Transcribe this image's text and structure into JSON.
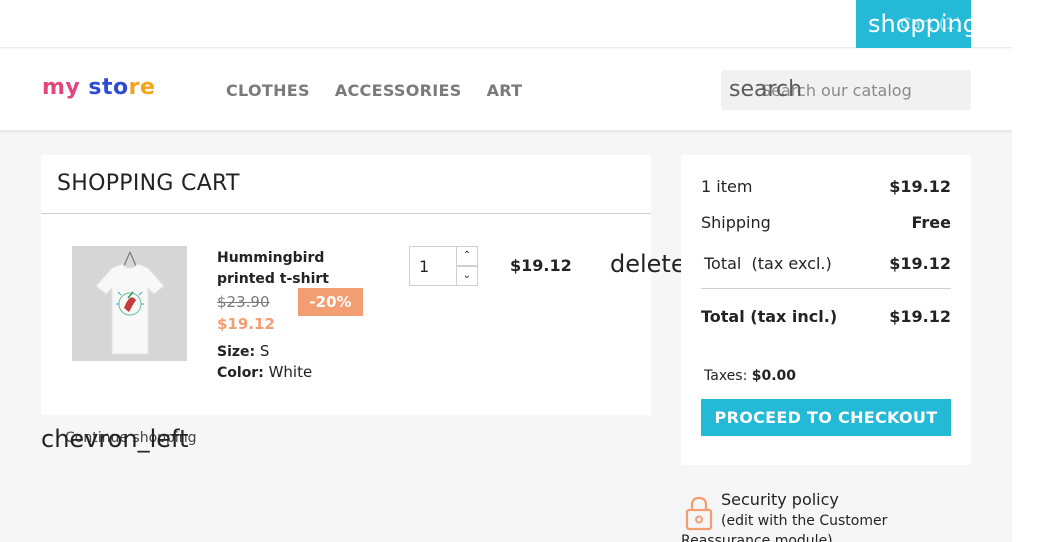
{
  "top_bar": {
    "cart_icon_label": "shopping_cart",
    "cart_text": "Cart (1)"
  },
  "header": {
    "logo": {
      "part1": "my",
      "part2": " sto",
      "part3": "re"
    },
    "nav": [
      {
        "label": "Clothes"
      },
      {
        "label": "Accessories"
      },
      {
        "label": "Art"
      }
    ],
    "search": {
      "icon_label": "search",
      "placeholder": "Search our catalog"
    }
  },
  "cart": {
    "title": "SHOPPING CART",
    "item": {
      "name": "Hummingbird printed t-shirt",
      "old_price": "$23.90",
      "discount": "-20%",
      "new_price": "$19.12",
      "size_label": "Size:",
      "size_value": "S",
      "color_label": "Color:",
      "color_value": "White",
      "quantity": "1",
      "line_total": "$19.12",
      "delete_icon_label": "delete"
    },
    "continue": {
      "icon_label": "chevron_left",
      "label": "Continue shopping"
    }
  },
  "summary": {
    "items_label": "1 item",
    "items_value": "$19.12",
    "shipping_label": "Shipping",
    "shipping_value": "Free",
    "total_excl_label": "Total  (tax excl.)",
    "total_excl_value": "$19.12",
    "total_incl_label": "Total (tax incl.)",
    "total_incl_value": "$19.12",
    "taxes_label": "Taxes:",
    "taxes_value": "$0.00",
    "checkout_label": "Proceed to checkout"
  },
  "reassurance": {
    "title": "Security policy",
    "description": "(edit with the Customer Reassurance module)",
    "icon": "lock-icon",
    "icon_color": "#f39d72"
  },
  "colors": {
    "accent": "#24b9d7",
    "discount": "#f39d72"
  }
}
